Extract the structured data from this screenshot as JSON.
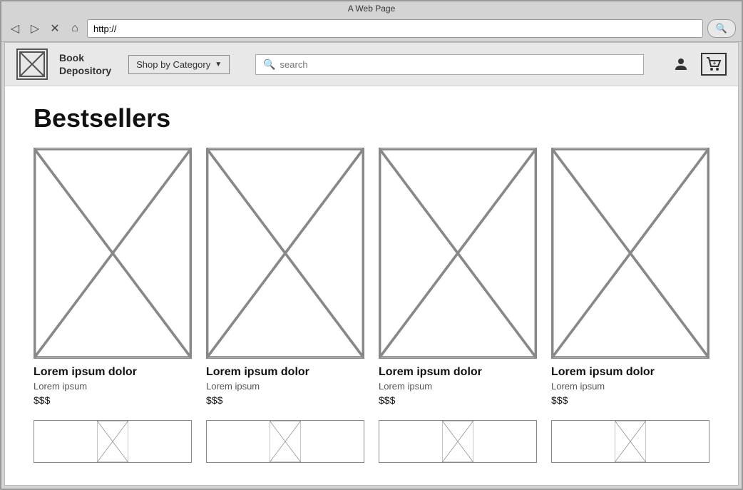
{
  "browser": {
    "title": "A Web Page",
    "address": "http://",
    "search_placeholder": "🔍",
    "nav_buttons": {
      "back": "◁",
      "forward": "▷",
      "close": "✕",
      "home": "⌂"
    }
  },
  "navbar": {
    "logo_text_line1": "Book",
    "logo_text_line2": "Depository",
    "category_button": "Shop by Category",
    "search_placeholder": "search"
  },
  "main": {
    "page_title": "Bestsellers",
    "products": [
      {
        "title": "Lorem ipsum dolor",
        "subtitle": "Lorem ipsum",
        "price": "$$$"
      },
      {
        "title": "Lorem ipsum dolor",
        "subtitle": "Lorem ipsum",
        "price": "$$$"
      },
      {
        "title": "Lorem ipsum dolor",
        "subtitle": "Lorem ipsum",
        "price": "$$$"
      },
      {
        "title": "Lorem ipsum dolor",
        "subtitle": "Lorem ipsum",
        "price": "$$$"
      },
      {
        "title": "",
        "subtitle": "",
        "price": ""
      },
      {
        "title": "",
        "subtitle": "",
        "price": ""
      },
      {
        "title": "",
        "subtitle": "",
        "price": ""
      },
      {
        "title": "",
        "subtitle": "",
        "price": ""
      }
    ]
  }
}
